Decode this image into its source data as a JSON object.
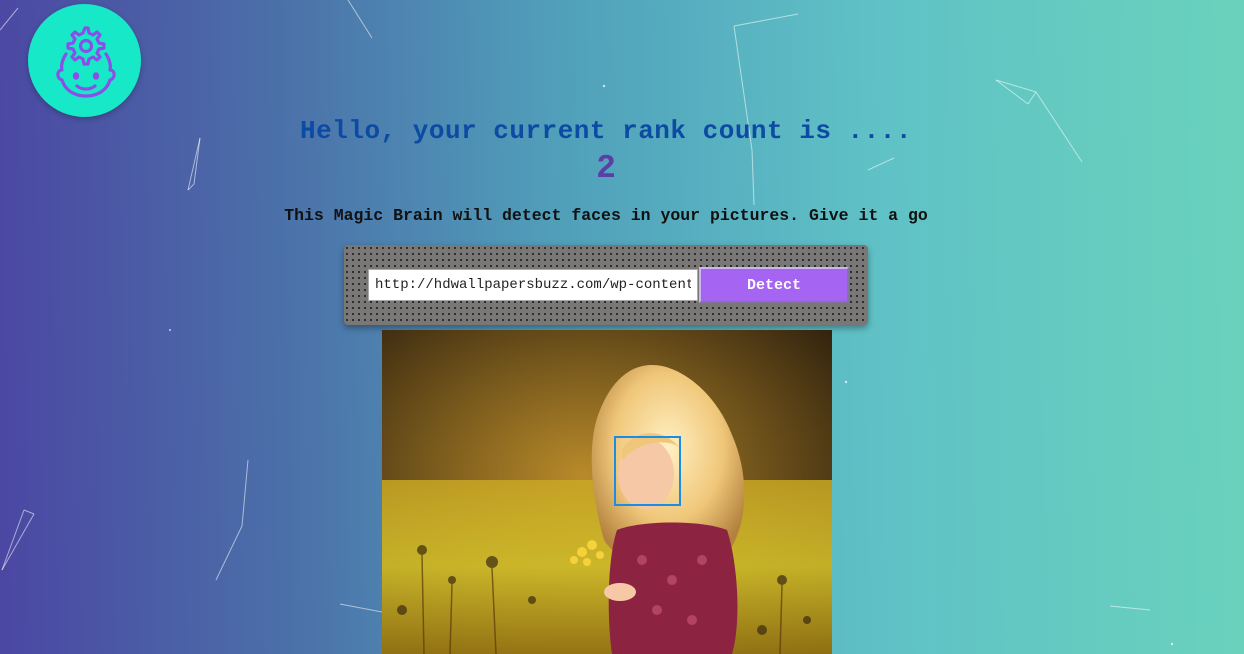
{
  "header": {
    "greeting": "Hello, your current rank count is ....",
    "rank": "2"
  },
  "intro": {
    "text": "This Magic Brain will detect faces in your pictures. Give it a go"
  },
  "form": {
    "url_value": "http://hdwallpapersbuzz.com/wp-content",
    "button_label": "Detect"
  },
  "image": {
    "faces_detected": 1
  },
  "colors": {
    "logo_bg": "#17e8c8",
    "logo_icon": "#8b4fe8",
    "greeting": "#0d4aa3",
    "rank": "#5b3ea7",
    "button": "#a564f2",
    "face_box": "#1a8ee6"
  },
  "icons": {
    "logo": "brain-gear-head-icon"
  }
}
